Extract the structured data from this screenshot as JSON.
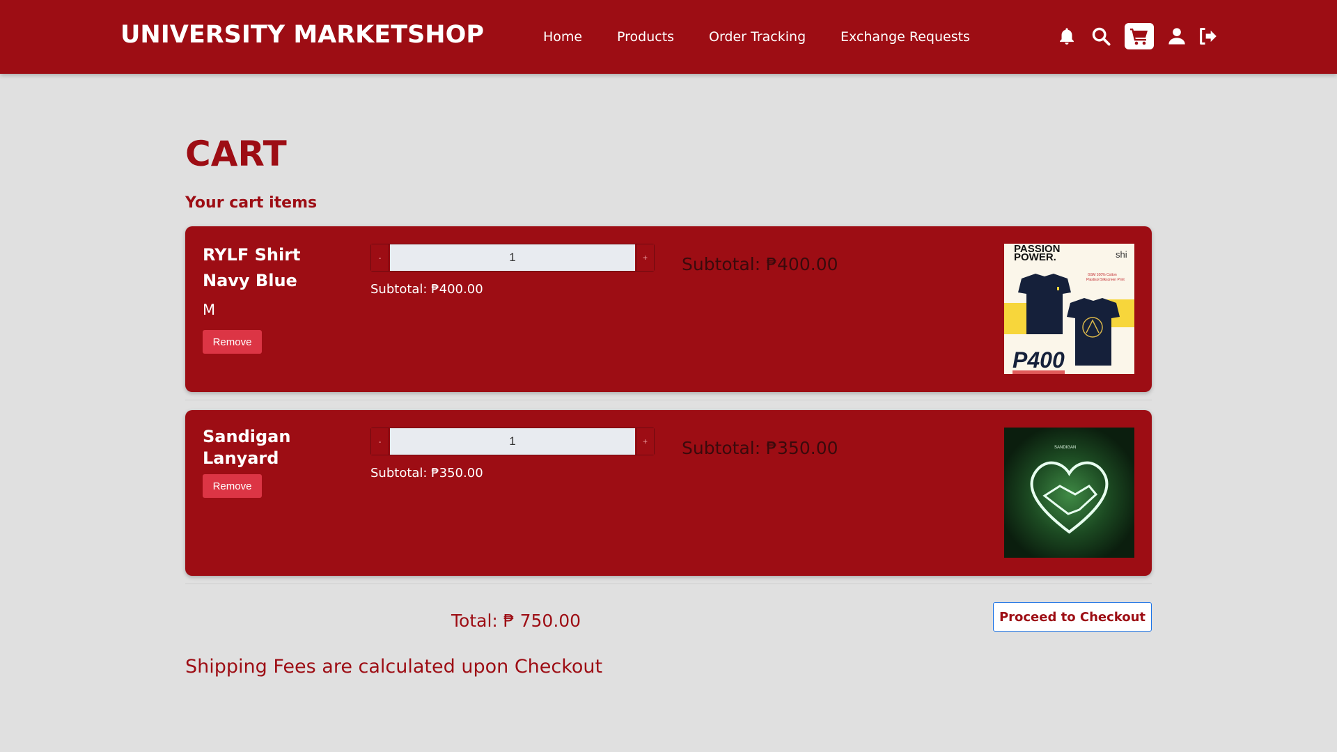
{
  "header": {
    "brand": "UNIVERSITY MARKETSHOP",
    "nav": [
      {
        "label": "Home"
      },
      {
        "label": "Products"
      },
      {
        "label": "Order Tracking"
      },
      {
        "label": "Exchange Requests"
      }
    ],
    "icons": [
      "bell-icon",
      "search-icon",
      "cart-icon",
      "user-icon",
      "logout-icon"
    ]
  },
  "page": {
    "title": "CART",
    "section_title": "Your cart items"
  },
  "cart": {
    "items": [
      {
        "name": "RYLF Shirt Navy Blue",
        "size": "M",
        "remove_label": "Remove",
        "quantity": "1",
        "minus_label": "-",
        "plus_label": "+",
        "subtotal_small": "Subtotal: ₱400.00",
        "subtotal_large": "Subtotal: ₱400.00",
        "image": {
          "headline_top": "PASSION",
          "headline_bottom": "POWER.",
          "price_tag": "P400",
          "side_text": "shi",
          "spec_line1": "GSM 100% Cotton",
          "spec_line2": "Plastisol Silkscreen Print"
        }
      },
      {
        "name": "Sandigan Lanyard",
        "size": "",
        "remove_label": "Remove",
        "quantity": "1",
        "minus_label": "-",
        "plus_label": "+",
        "subtotal_small": "Subtotal: ₱350.00",
        "subtotal_large": "Subtotal: ₱350.00",
        "image": {
          "logo_text": "SANDIGAN"
        }
      }
    ],
    "total": "Total: ₱ 750.00",
    "checkout_label": "Proceed to Checkout",
    "shipping_note": "Shipping Fees are calculated upon Checkout"
  },
  "colors": {
    "primary": "#9d0d14",
    "background": "#e0e0e0",
    "remove": "#dc3545"
  }
}
